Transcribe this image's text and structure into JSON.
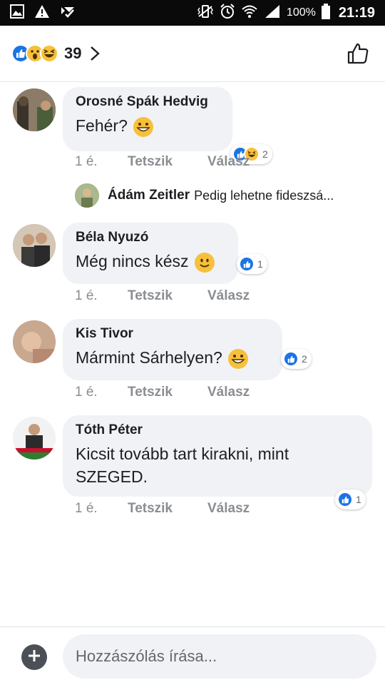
{
  "status_bar": {
    "battery": "100%",
    "time": "21:19",
    "icons": [
      "image-icon",
      "warning-icon",
      "check-badge-icon",
      "vibrate-icon",
      "alarm-icon",
      "wifi-icon",
      "signal-icon",
      "battery-icon"
    ]
  },
  "header": {
    "reaction_icons": [
      "like-icon",
      "wow-icon",
      "haha-icon"
    ],
    "reaction_count": "39"
  },
  "comments": [
    {
      "author": "Orosné Spák Hedvig",
      "text": "Fehér?",
      "emoji": "grin-emoji",
      "reactions": [
        "like",
        "haha"
      ],
      "reaction_count": "2",
      "time": "1 é.",
      "like_label": "Tetszik",
      "reply_label": "Válasz",
      "reply_preview": {
        "author": "Ádám Zeitler",
        "text": "Pedig lehetne fideszsá..."
      }
    },
    {
      "author": "Béla Nyuzó",
      "text": "Még nincs kész",
      "emoji": "smile-emoji",
      "reactions": [
        "like"
      ],
      "reaction_count": "1",
      "time": "1 é.",
      "like_label": "Tetszik",
      "reply_label": "Válasz"
    },
    {
      "author": "Kis Tivor",
      "text": "Mármint Sárhelyen?",
      "emoji": "grin-emoji",
      "reactions": [
        "like"
      ],
      "reaction_count": "2",
      "time": "1 é.",
      "like_label": "Tetszik",
      "reply_label": "Válasz"
    },
    {
      "author": "Tóth Péter",
      "text": "Kicsit tovább tart kirakni, mint SZEGED.",
      "reactions": [
        "like"
      ],
      "reaction_count": "1",
      "time": "1 é.",
      "like_label": "Tetszik",
      "reply_label": "Válasz"
    }
  ],
  "composer": {
    "placeholder": "Hozzászólás írása..."
  },
  "colors": {
    "accent": "#1b74e4",
    "bubble": "#f0f2f5",
    "meta": "#8a8d91",
    "statusbar": "#0a0a0a"
  }
}
